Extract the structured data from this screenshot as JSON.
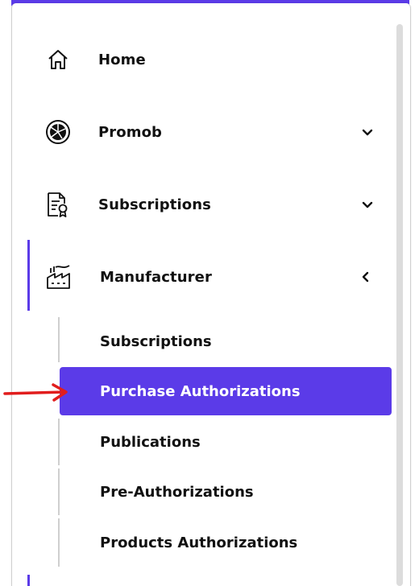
{
  "colors": {
    "accent": "#5b3be8",
    "arrow": "#e11d1d",
    "text": "#111111",
    "selected_text": "#ffffff"
  },
  "nav": {
    "items": [
      {
        "label": "Home",
        "icon": "home-icon",
        "expandable": false
      },
      {
        "label": "Promob",
        "icon": "pie-chart-icon",
        "expandable": true,
        "state": "collapsed"
      },
      {
        "label": "Subscriptions",
        "icon": "certificate-document-icon",
        "expandable": true,
        "state": "collapsed"
      },
      {
        "label": "Manufacturer",
        "icon": "factory-icon",
        "expandable": true,
        "state": "expanded"
      }
    ]
  },
  "manufacturer_submenu": {
    "items": [
      {
        "label": "Subscriptions",
        "selected": false
      },
      {
        "label": "Purchase Authorizations",
        "selected": true
      },
      {
        "label": "Publications",
        "selected": false
      },
      {
        "label": "Pre-Authorizations",
        "selected": false
      },
      {
        "label": "Products Authorizations",
        "selected": false
      }
    ]
  },
  "annotation": {
    "icon": "red-arrow-icon"
  }
}
